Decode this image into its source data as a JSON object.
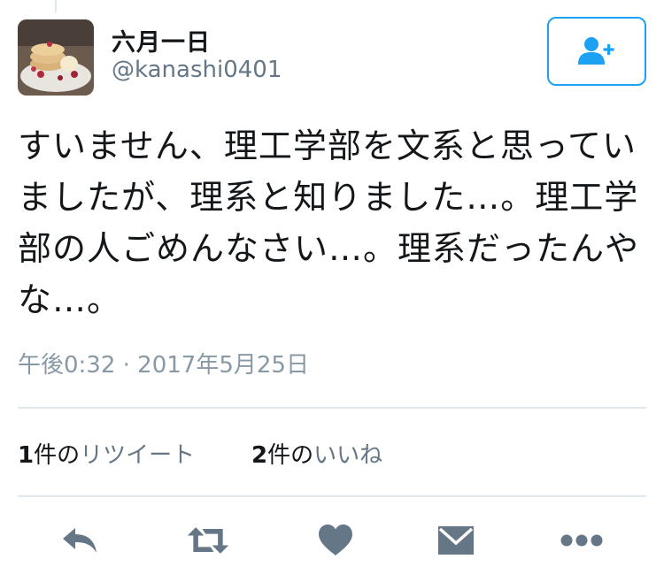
{
  "user": {
    "display_name": "六月一日",
    "handle": "@kanashi0401"
  },
  "tweet": {
    "lines": [
      "すいません、理工学部を文系と思ってい",
      "ましたが、理系と知りました…。理工学",
      "部の人ごめんなさい…。理系だったんや",
      "な…。"
    ],
    "timestamp": "午後0:32 · 2017年5月25日"
  },
  "stats": {
    "retweets": {
      "count": "1",
      "suffix": "件の",
      "label": "リツイート"
    },
    "likes": {
      "count": "2",
      "suffix": "件の",
      "label": "いいね"
    }
  },
  "icons": {
    "follow": "follow-user-icon",
    "reply": "reply-icon",
    "retweet": "retweet-icon",
    "like": "heart-icon",
    "dm": "envelope-icon",
    "more": "more-icon"
  },
  "colors": {
    "accent": "#1da1f2",
    "action_icon": "#657786",
    "muted_text": "#8899a6",
    "divider": "#e1e8ed"
  }
}
